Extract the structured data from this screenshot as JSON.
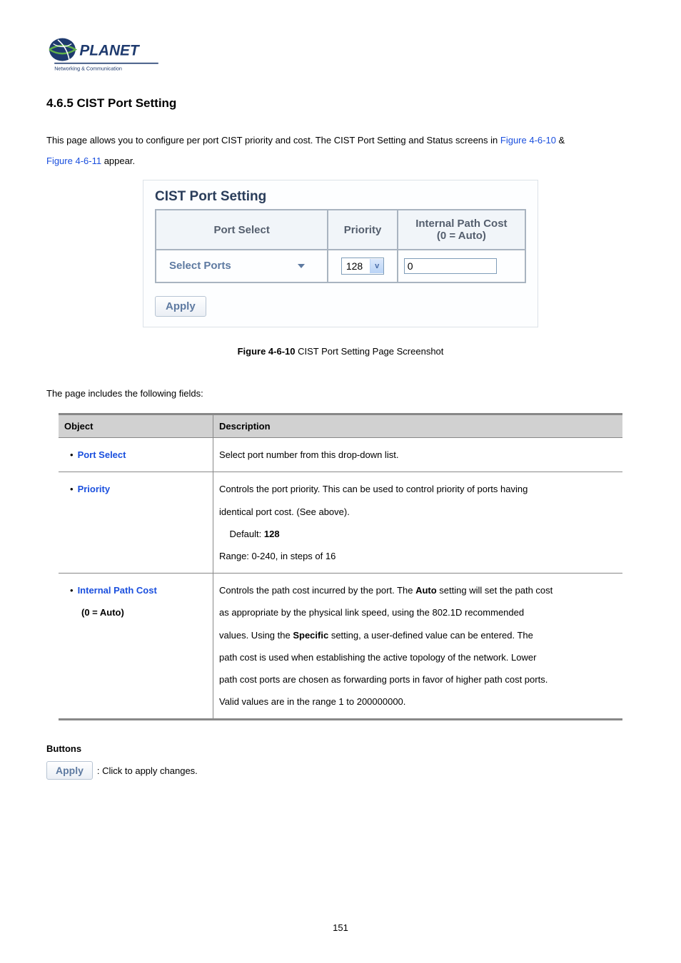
{
  "logo": {
    "brand": "PLANET",
    "tagline": "Networking & Communication"
  },
  "heading": "4.6.5 CIST Port Setting",
  "intro": {
    "part1": "This page allows you to configure per port CIST priority and cost. The CIST Port Setting and Status screens in ",
    "ref1": "Figure 4-6-10",
    "part2": " & ",
    "ref2": "Figure 4-6-11",
    "part3": " appear."
  },
  "cist": {
    "title": "CIST Port Setting",
    "headers": {
      "port_select": "Port Select",
      "priority": "Priority",
      "ipc_line1": "Internal Path Cost",
      "ipc_line2": "(0 = Auto)"
    },
    "row": {
      "select_ports": "Select Ports",
      "priority_value": "128",
      "ipc_value": "0"
    },
    "apply": "Apply"
  },
  "figcaption": {
    "bold": "Figure 4-6-10",
    "rest": " CIST Port Setting Page Screenshot"
  },
  "fields_intro": "The page includes the following fields:",
  "table": {
    "head_object": "Object",
    "head_desc": "Description",
    "rows": [
      {
        "obj": "Port Select",
        "desc": "Select port number from this drop-down list."
      },
      {
        "obj": "Priority",
        "desc_l1": "Controls the port priority. This can be used to control priority of ports having",
        "desc_l2": "identical port cost. (See above).",
        "desc_def_label": "Default: ",
        "desc_def_val": "128",
        "desc_range": "Range: 0-240, in steps of 16"
      },
      {
        "obj_l1": "Internal Path Cost",
        "obj_l2": "(0 = Auto)",
        "d1a": "Controls the path cost incurred by the port. The ",
        "d1b": "Auto",
        "d1c": " setting will set the path cost",
        "d2": "as appropriate by the physical link speed, using the 802.1D recommended",
        "d3a": "values. Using the ",
        "d3b": "Specific",
        "d3c": " setting, a user-defined value can be entered. The",
        "d4": "path cost is used when establishing the active topology of the network. Lower",
        "d5": "path cost ports are chosen as forwarding ports in favor of higher path cost ports.",
        "d6": "Valid values are in the range 1 to 200000000."
      }
    ]
  },
  "buttons": {
    "heading": "Buttons",
    "apply": "Apply",
    "apply_desc": ": Click to apply changes."
  },
  "pagenum": "151"
}
